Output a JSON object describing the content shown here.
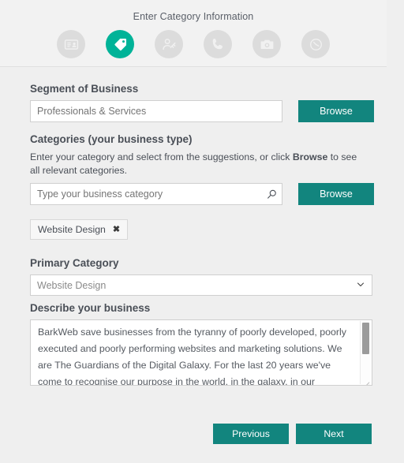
{
  "header": {
    "title": "Enter Category Information",
    "steps": [
      {
        "icon": "business-card-icon",
        "name": "step-business-info",
        "active": false
      },
      {
        "icon": "tag-icon",
        "name": "step-category",
        "active": true
      },
      {
        "icon": "person-search-icon",
        "name": "step-people",
        "active": false
      },
      {
        "icon": "phone-icon",
        "name": "step-contact",
        "active": false
      },
      {
        "icon": "camera-icon",
        "name": "step-photos",
        "active": false
      },
      {
        "icon": "clock-icon",
        "name": "step-hours",
        "active": false
      }
    ]
  },
  "form": {
    "segment": {
      "label": "Segment of Business",
      "value": "Professionals & Services",
      "placeholder": "Professionals & Services",
      "browse_label": "Browse"
    },
    "categories": {
      "label": "Categories (your business type)",
      "helper_prefix": "Enter your category and select from the suggestions, or click ",
      "helper_bold": "Browse",
      "helper_suffix": " to see all relevant categories.",
      "input_value": "",
      "placeholder": "Type your business category",
      "search_icon": "search-icon",
      "browse_label": "Browse",
      "chips": [
        {
          "label": "Website Design",
          "remove_label": "✖"
        }
      ]
    },
    "primary_category": {
      "label": "Primary Category",
      "selected": "Website Design",
      "options": [
        "Website Design"
      ]
    },
    "description": {
      "label": "Describe your business",
      "value": "BarkWeb save businesses from the tyranny of poorly developed, poorly executed and poorly performing websites and marketing solutions. We are The Guardians of the Digital Galaxy. For the last 20 years we've come to recognise our purpose in the world, in the galaxy, in our universe. BarkWeb"
    }
  },
  "footer": {
    "previous_label": "Previous",
    "next_label": "Next"
  },
  "colors": {
    "accent_active": "#00b398",
    "accent_button": "#12857e",
    "page_background": "#efefef",
    "header_background": "#f2f2f2",
    "step_inactive": "#dcdcdc"
  }
}
